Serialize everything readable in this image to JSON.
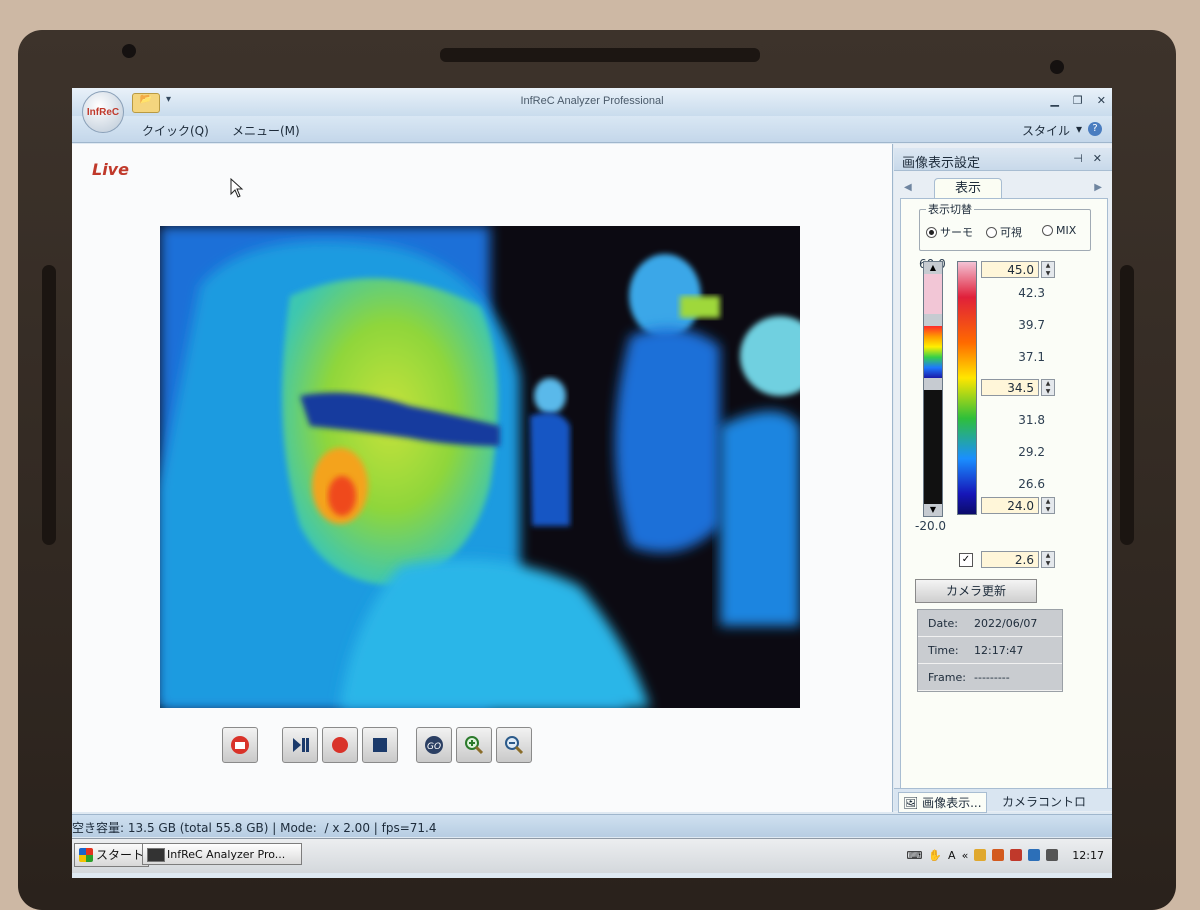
{
  "app": {
    "title": "InfReC Analyzer Professional",
    "logo_text": "InfReC"
  },
  "menu": {
    "quick": "クイック(Q)",
    "menu": "メニュー(M)",
    "style": "スタイル",
    "style_arrow": "▾",
    "help": "?"
  },
  "main": {
    "live_label": "Live"
  },
  "side_panel": {
    "title": "画像表示設定",
    "tab_active": "表示",
    "display_mode": {
      "legend": "表示切替",
      "options": [
        {
          "label": "サーモ",
          "selected": true
        },
        {
          "label": "可視",
          "selected": false
        },
        {
          "label": "MIX",
          "selected": false
        }
      ]
    },
    "scale": {
      "max_label": "60.0",
      "min_label": "-20.0",
      "upper_value": "45.0",
      "mid_value": "34.5",
      "lower_value": "24.0",
      "ticks": [
        "42.3",
        "39.7",
        "37.1",
        "31.8",
        "29.2",
        "26.6"
      ]
    },
    "emissivity_checked": true,
    "step_value": "2.6",
    "camera_update": "カメラ更新",
    "info": [
      {
        "key": "Date:",
        "value": "2022/06/07"
      },
      {
        "key": "Time:",
        "value": "12:17:47"
      },
      {
        "key": "Frame:",
        "value": "---------"
      }
    ],
    "bottom_tabs": [
      "画像表示...",
      "カメラコントロー..."
    ]
  },
  "status": {
    "text": "空き容量: 13.5 GB (total 55.8 GB) | Mode:  / x 2.00 | fps=71.4"
  },
  "taskbar": {
    "start": "スタート",
    "task": "InfReC Analyzer Pro...",
    "time": "12:17"
  },
  "colors": {
    "live": "#c0392b",
    "accent": "#4a7dc0"
  }
}
